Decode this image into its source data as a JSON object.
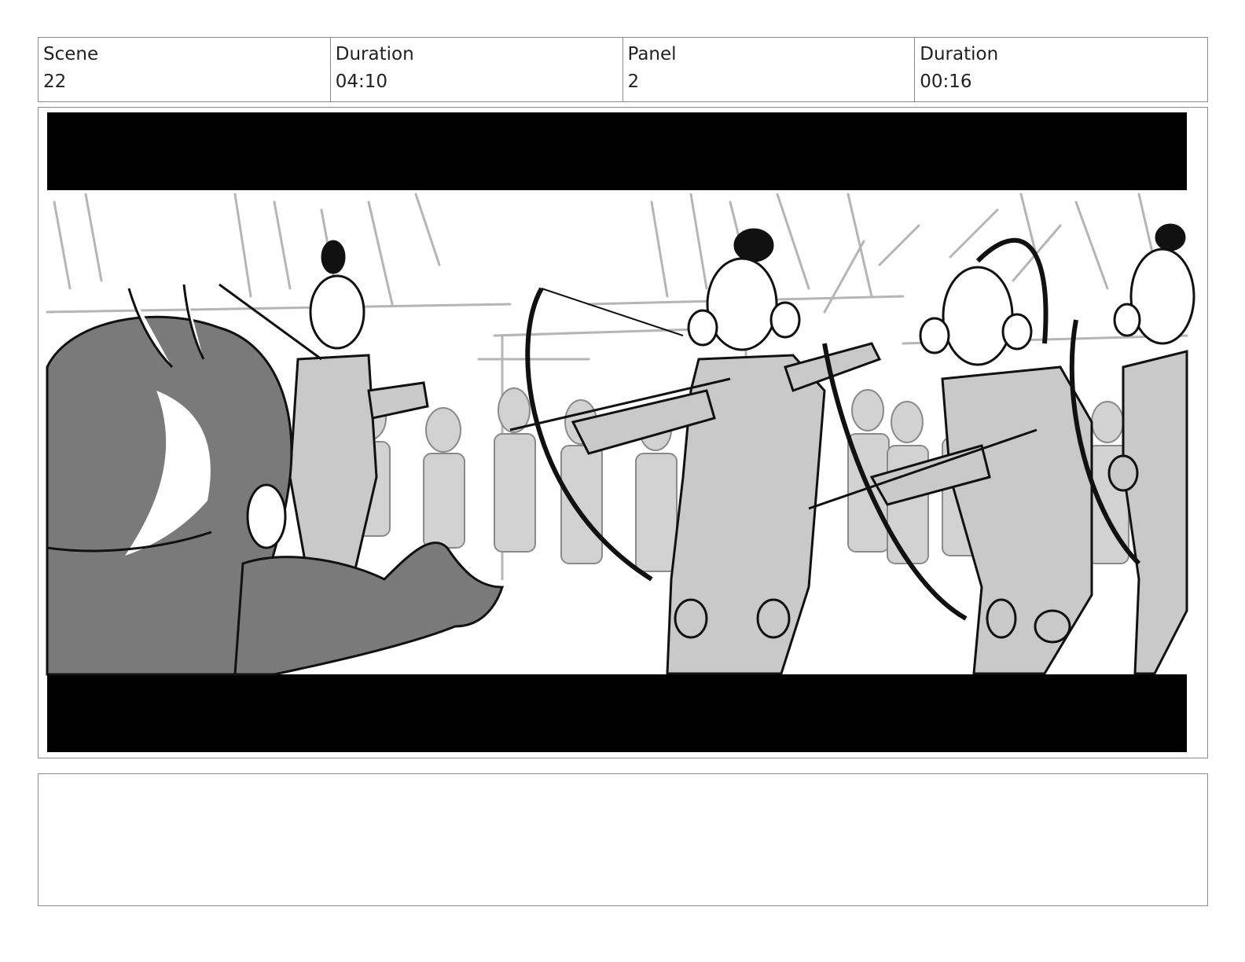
{
  "header": {
    "scene_label": "Scene",
    "scene_value": "22",
    "duration_label": "Duration",
    "scene_duration": "04:10",
    "panel_label": "Panel",
    "panel_value": "2",
    "panel_duration_label": "Duration",
    "panel_duration": "00:16"
  },
  "notes": {
    "text": ""
  }
}
